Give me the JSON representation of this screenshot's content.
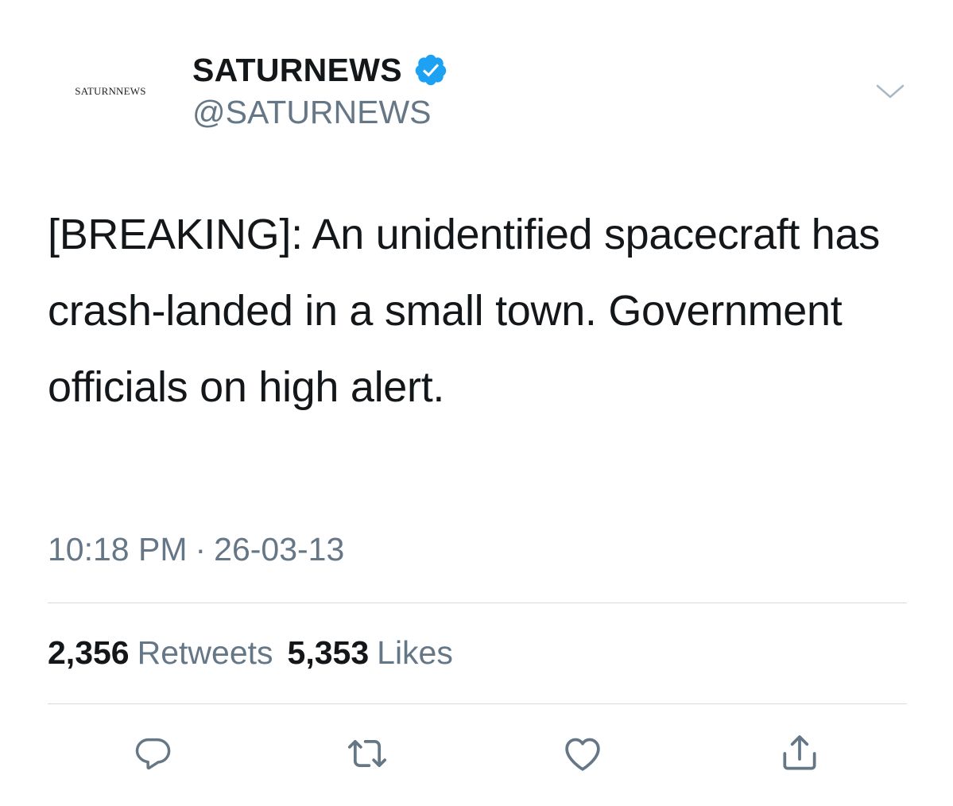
{
  "account": {
    "avatar_text": "SATURNNEWS",
    "display_name": "SATURNEWS",
    "handle": "@SATURNEWS",
    "verified": true,
    "verified_color": "#1da1f2"
  },
  "tweet": {
    "text": "[BREAKING]: An unidentified spacecraft has crash-landed in a small town. Government officials on high alert.",
    "time": "10:18 PM",
    "separator": "·",
    "date": "26-03-13"
  },
  "stats": {
    "retweets_count": "2,356",
    "retweets_label": "Retweets",
    "likes_count": "5,353",
    "likes_label": "Likes"
  },
  "actions": {
    "icons": [
      "reply-icon",
      "retweet-icon",
      "like-icon",
      "share-icon"
    ],
    "icon_color": "#657786"
  },
  "menu": {
    "icon": "chevron-down-icon"
  }
}
